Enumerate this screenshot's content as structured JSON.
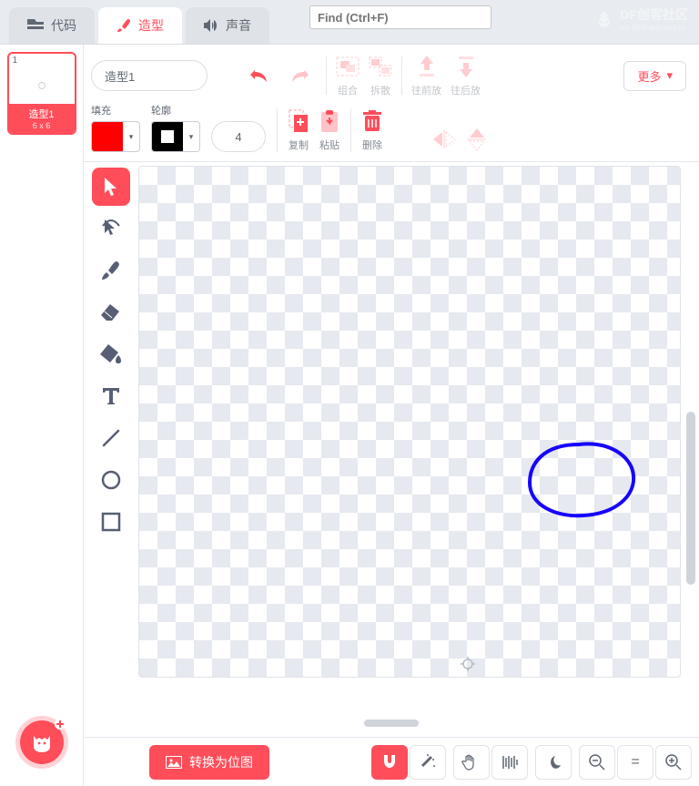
{
  "tabs": {
    "code": "代码",
    "costumes": "造型",
    "sounds": "声音"
  },
  "find_placeholder": "Find (Ctrl+F)",
  "watermark": {
    "title": "DF创客社区",
    "sub": "mc.DFRobot.com.cn"
  },
  "thumb": {
    "index": "1",
    "name": "造型1",
    "dim": "6 x 6"
  },
  "costume_name": "造型1",
  "row1": {
    "group": "组合",
    "ungroup": "拆散",
    "forward": "往前放",
    "backward": "往后放",
    "more": "更多"
  },
  "row2": {
    "fill": "填充",
    "outline": "轮廓",
    "width": "4",
    "copy": "复制",
    "paste": "粘贴",
    "delete": "删除"
  },
  "bottom": {
    "convert": "转换为位图",
    "equals": "="
  },
  "colors": {
    "accent": "#ff4d5a",
    "fill": "#ff0000",
    "annotation": "#1600ff"
  }
}
